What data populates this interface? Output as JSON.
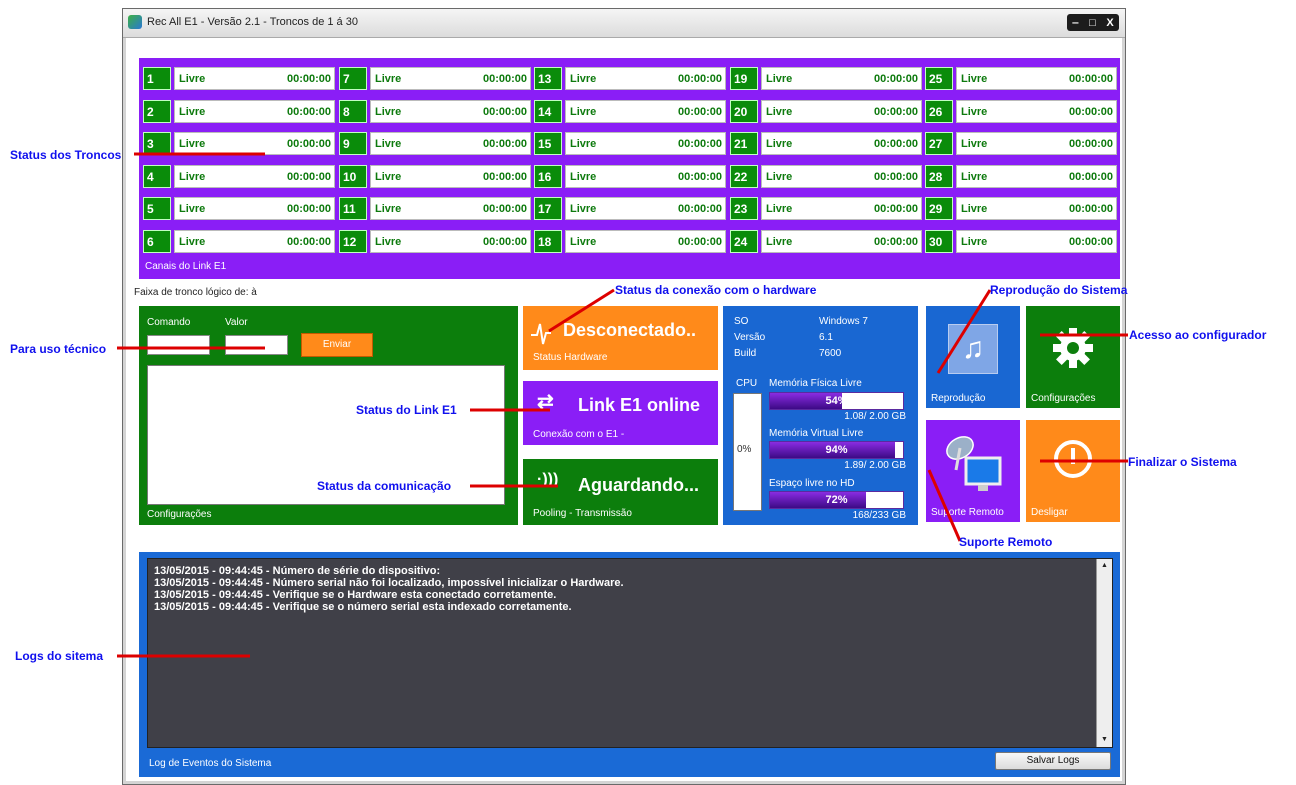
{
  "window": {
    "title": "Rec All E1 - Versão 2.1 - Troncos de 1 á 30",
    "controls": [
      "‒",
      "□",
      "X"
    ]
  },
  "trunks": {
    "caption": "Canais do Link E1",
    "items": [
      {
        "num": "1",
        "status": "Livre",
        "time": "00:00:00"
      },
      {
        "num": "2",
        "status": "Livre",
        "time": "00:00:00"
      },
      {
        "num": "3",
        "status": "Livre",
        "time": "00:00:00"
      },
      {
        "num": "4",
        "status": "Livre",
        "time": "00:00:00"
      },
      {
        "num": "5",
        "status": "Livre",
        "time": "00:00:00"
      },
      {
        "num": "6",
        "status": "Livre",
        "time": "00:00:00"
      },
      {
        "num": "7",
        "status": "Livre",
        "time": "00:00:00"
      },
      {
        "num": "8",
        "status": "Livre",
        "time": "00:00:00"
      },
      {
        "num": "9",
        "status": "Livre",
        "time": "00:00:00"
      },
      {
        "num": "10",
        "status": "Livre",
        "time": "00:00:00"
      },
      {
        "num": "11",
        "status": "Livre",
        "time": "00:00:00"
      },
      {
        "num": "12",
        "status": "Livre",
        "time": "00:00:00"
      },
      {
        "num": "13",
        "status": "Livre",
        "time": "00:00:00"
      },
      {
        "num": "14",
        "status": "Livre",
        "time": "00:00:00"
      },
      {
        "num": "15",
        "status": "Livre",
        "time": "00:00:00"
      },
      {
        "num": "16",
        "status": "Livre",
        "time": "00:00:00"
      },
      {
        "num": "17",
        "status": "Livre",
        "time": "00:00:00"
      },
      {
        "num": "18",
        "status": "Livre",
        "time": "00:00:00"
      },
      {
        "num": "19",
        "status": "Livre",
        "time": "00:00:00"
      },
      {
        "num": "20",
        "status": "Livre",
        "time": "00:00:00"
      },
      {
        "num": "21",
        "status": "Livre",
        "time": "00:00:00"
      },
      {
        "num": "22",
        "status": "Livre",
        "time": "00:00:00"
      },
      {
        "num": "23",
        "status": "Livre",
        "time": "00:00:00"
      },
      {
        "num": "24",
        "status": "Livre",
        "time": "00:00:00"
      },
      {
        "num": "25",
        "status": "Livre",
        "time": "00:00:00"
      },
      {
        "num": "26",
        "status": "Livre",
        "time": "00:00:00"
      },
      {
        "num": "27",
        "status": "Livre",
        "time": "00:00:00"
      },
      {
        "num": "28",
        "status": "Livre",
        "time": "00:00:00"
      },
      {
        "num": "29",
        "status": "Livre",
        "time": "00:00:00"
      },
      {
        "num": "30",
        "status": "Livre",
        "time": "00:00:00"
      }
    ]
  },
  "faixa_label": "Faixa de tronco lógico de:  à",
  "tech": {
    "comando_label": "Comando",
    "valor_label": "Valor",
    "comando_value": "",
    "valor_value": "",
    "enviar_label": "Enviar",
    "caption": "Configurações"
  },
  "hardware_tile": {
    "title": "Desconectado..",
    "sub": "Status Hardware",
    "color": "#ff8a1a"
  },
  "link_tile": {
    "title": "Link E1 online",
    "sub": "Conexão com o E1 -",
    "color": "#8a1ef6"
  },
  "comm_tile": {
    "title": "Aguardando...",
    "sub": "Pooling - Transmissão",
    "color": "#0c7e0c"
  },
  "sysinfo": {
    "so_label": "SO",
    "so_value": "Windows 7",
    "versao_label": "Versão",
    "versao_value": "6.1",
    "build_label": "Build",
    "build_value": "7600",
    "cpu_label": "CPU",
    "cpu_value": "0%",
    "mem_fisica_label": "Memória Física Livre",
    "mem_fisica_pct": "54%",
    "mem_fisica_fraction": 0.54,
    "mem_fisica_gb": "1.08/ 2.00 GB",
    "mem_virtual_label": "Memória Virtual Livre",
    "mem_virtual_pct": "94%",
    "mem_virtual_fraction": 0.94,
    "mem_virtual_gb": "1.89/ 2.00 GB",
    "hd_label": "Espaço livre no HD",
    "hd_pct": "72%",
    "hd_fraction": 0.72,
    "hd_gb": "168/233 GB"
  },
  "right_tiles": {
    "reproducao": "Reprodução",
    "configuracoes": "Configurações",
    "suporte": "Suporte Remoto",
    "desligar": "Desligar"
  },
  "logs": {
    "lines": [
      "13/05/2015 - 09:44:45 - Número de série do dispositivo:",
      "13/05/2015 - 09:44:45 - Número serial não foi localizado, impossível inicializar o Hardware.",
      "13/05/2015 - 09:44:45 - Verifique se o Hardware esta conectado corretamente.",
      "13/05/2015 - 09:44:45 - Verifique se o número serial esta indexado corretamente."
    ],
    "caption": "Log de Eventos do Sistema",
    "save_label": "Salvar Logs"
  },
  "annotations": {
    "status_troncos": "Status dos Troncos",
    "uso_tecnico": "Para uso técnico",
    "conexao_hardware": "Status da conexão com o hardware",
    "link_e1": "Status do Link E1",
    "comunicacao": "Status da comunicação",
    "reproducao": "Reprodução do Sistema",
    "configurador": "Acesso ao configurador",
    "finalizar": "Finalizar o Sistema",
    "suporte": "Suporte Remoto",
    "logs": "Logs do sitema"
  }
}
